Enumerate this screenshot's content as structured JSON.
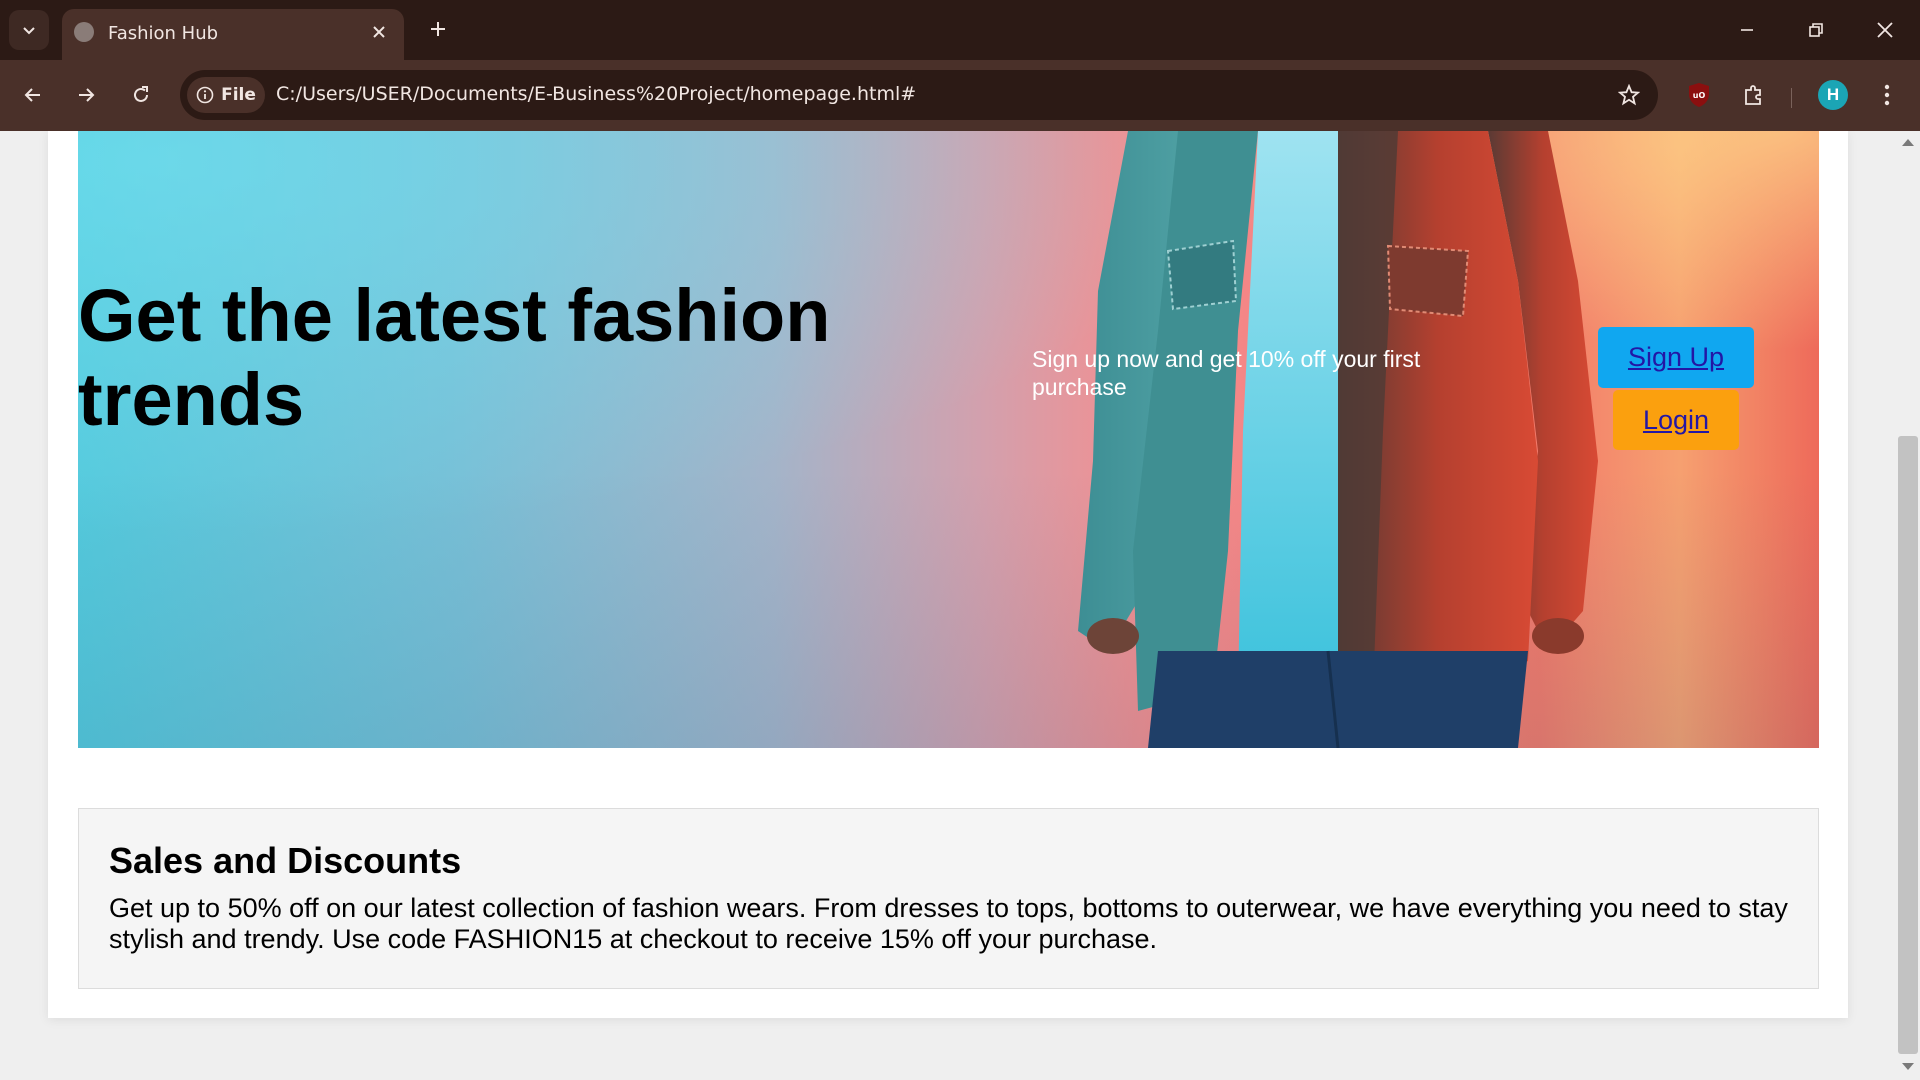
{
  "browser": {
    "tab_title": "Fashion Hub",
    "site_chip": "File",
    "url": "C:/Users/USER/Documents/E-Business%20Project/homepage.html#",
    "profile_initial": "H",
    "accent_color": "#1ba5b5"
  },
  "hero": {
    "heading": "Get the latest fashion trends",
    "subtext": "Sign up now and get 10% off your first purchase",
    "signup_label": "Sign Up",
    "login_label": "Login",
    "signup_color": "#10a7f0",
    "login_color": "#fba00e"
  },
  "sales": {
    "title": "Sales and Discounts",
    "text": "Get up to 50% off on our latest collection of fashion wears. From dresses to tops, bottoms to outerwear, we have everything you need to stay stylish and trendy. Use code FASHION15 at checkout to receive 15% off your purchase."
  }
}
